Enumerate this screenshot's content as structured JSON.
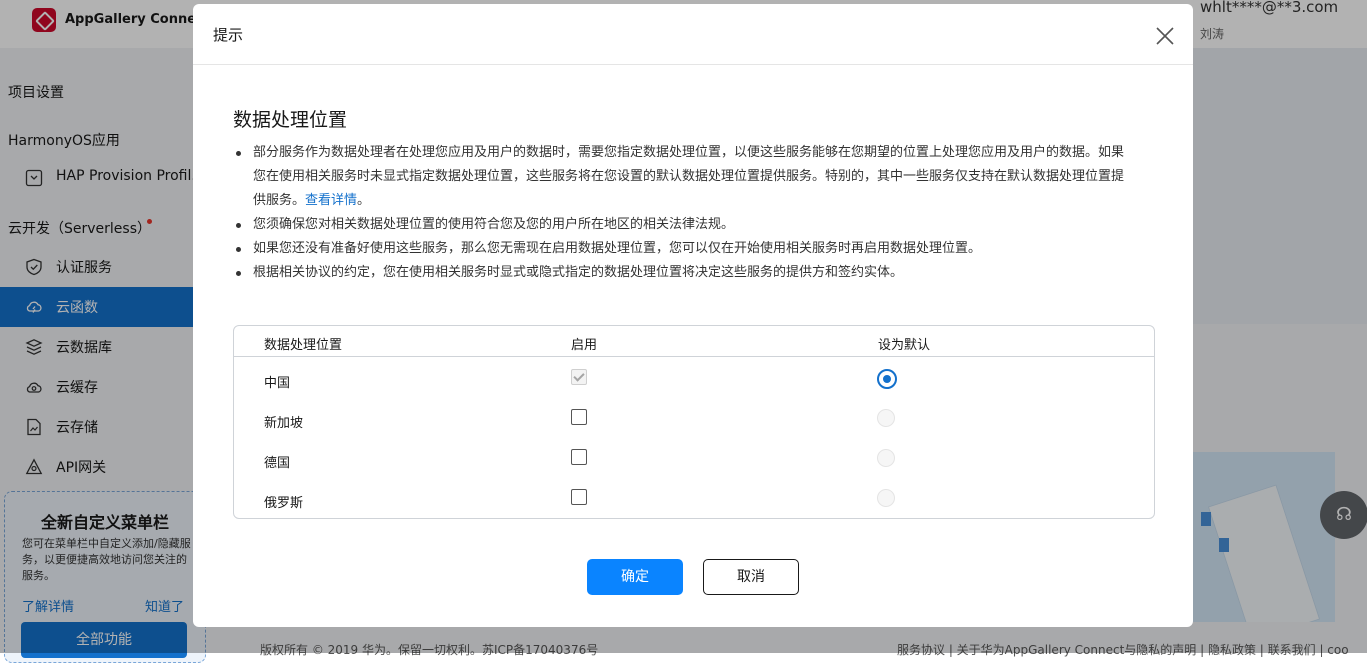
{
  "app": {
    "title": "AppGallery Connect"
  },
  "user": {
    "email": "whlt****@**3.com",
    "name": "刘涛"
  },
  "sidebar": {
    "project_settings": "项目设置",
    "harmony_section": "HarmonyOS应用",
    "hap_item": "HAP Provision Profil...",
    "serverless_section": "云开发（Serverless）",
    "items": [
      {
        "label": "认证服务",
        "icon": "shield-icon",
        "active": false
      },
      {
        "label": "云函数",
        "icon": "cloud-function-icon",
        "active": true
      },
      {
        "label": "云数据库",
        "icon": "database-icon",
        "active": false
      },
      {
        "label": "云缓存",
        "icon": "cache-icon",
        "active": false
      },
      {
        "label": "云存储",
        "icon": "storage-icon",
        "active": false
      },
      {
        "label": "API网关",
        "icon": "gateway-icon",
        "active": false
      }
    ],
    "promo": {
      "title": "全新自定义菜单栏",
      "text": "您可在菜单栏中自定义添加/隐藏服务，以更便捷高效地访问您关注的服务。",
      "learn_more": "了解详情",
      "got_it": "知道了"
    },
    "all_features": "全部功能"
  },
  "footer": {
    "copyright": "版权所有 © 2019 华为。保留一切权利。苏ICP备17040376号",
    "links": "服务协议 | 关于华为AppGallery Connect与隐私的声明 | 隐私政策 | 联系我们 | coo"
  },
  "dialog": {
    "header": "提示",
    "title": "数据处理位置",
    "bullets": {
      "b1_text": "部分服务作为数据处理者在处理您应用及用户的数据时，需要您指定数据处理位置，以便这些服务能够在您期望的位置上处理您应用及用户的数据。如果您在使用相关服务时未显式指定数据处理位置，这些服务将在您设置的默认数据处理位置提供服务。特别的，其中一些服务仅支持在默认数据处理位置提供服务。",
      "b1_link": "查看详情",
      "b1_end": "。",
      "b2": "您须确保您对相关数据处理位置的使用符合您及您的用户所在地区的相关法律法规。",
      "b3": "如果您还没有准备好使用这些服务，那么您无需现在启用数据处理位置，您可以仅在开始使用相关服务时再启用数据处理位置。",
      "b4": "根据相关协议的约定，您在使用相关服务时显式或隐式指定的数据处理位置将决定这些服务的提供方和签约实体。"
    },
    "table": {
      "headers": {
        "location": "数据处理位置",
        "enable": "启用",
        "default": "设为默认"
      },
      "rows": [
        {
          "location": "中国",
          "enabled": true,
          "enable_disabled": true,
          "is_default": true
        },
        {
          "location": "新加坡",
          "enabled": false,
          "enable_disabled": false,
          "is_default": false
        },
        {
          "location": "德国",
          "enabled": false,
          "enable_disabled": false,
          "is_default": false
        },
        {
          "location": "俄罗斯",
          "enabled": false,
          "enable_disabled": false,
          "is_default": false
        }
      ]
    },
    "ok_label": "确定",
    "cancel_label": "取消"
  },
  "colors": {
    "primary": "#0a84ff",
    "sidebar_active": "#1471cc",
    "brand_red": "#cf0a2c"
  }
}
